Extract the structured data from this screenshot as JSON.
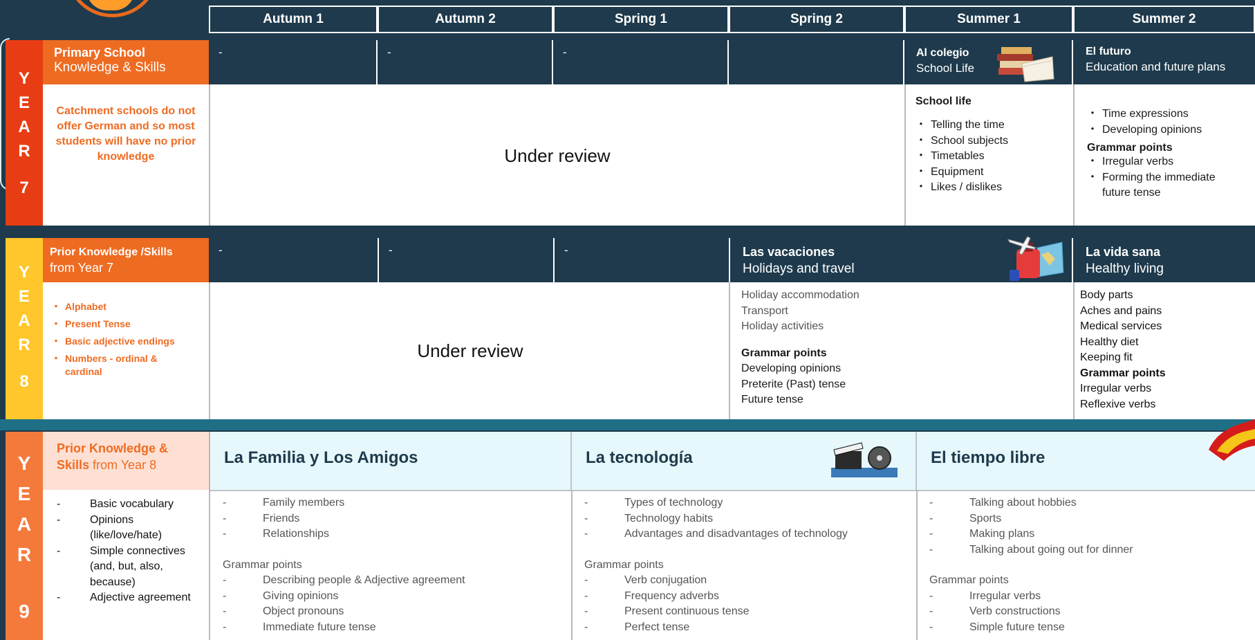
{
  "header": [
    "Autumn 1",
    "Autumn 2",
    "Spring 1",
    "Spring 2",
    "Summer 1",
    "Summer 2"
  ],
  "year7": {
    "label": [
      "Y",
      "E",
      "A",
      "R"
    ],
    "number": "7",
    "prior_title": "Primary School",
    "prior_sub": "Knowledge & Skills",
    "prior_text": "Catchment schools do not offer German and so most students will have no prior knowledge",
    "dashes": [
      "-",
      "-",
      "-"
    ],
    "review": "Under review",
    "summer1": {
      "title": "Al colegio",
      "sub": "School Life",
      "heading": "School life",
      "items": [
        "Telling the time",
        "School subjects",
        "Timetables",
        "Equipment",
        "Likes / dislikes"
      ]
    },
    "summer2": {
      "title": "El futuro",
      "sub": "Education and future plans",
      "items": [
        "Time expressions",
        "Developing opinions"
      ],
      "grammar_heading": "Grammar points",
      "grammar": [
        "Irregular verbs",
        "Forming the immediate future tense"
      ]
    }
  },
  "year8": {
    "label": [
      "Y",
      "E",
      "A",
      "R"
    ],
    "number": "8",
    "prior_title": "Prior Knowledge /Skills",
    "prior_sub": "from Year 7",
    "prior_items": [
      "Alphabet",
      "Present Tense",
      "Basic adjective endings",
      "Numbers - ordinal & cardinal"
    ],
    "dashes": [
      "-",
      "-",
      "-"
    ],
    "review": "Under review",
    "vacaciones": {
      "title": "Las vacaciones",
      "sub": "Holidays and travel",
      "items": [
        "Holiday accommodation",
        "Transport",
        "Holiday activities"
      ],
      "grammar_heading": "Grammar points",
      "grammar": [
        "Developing opinions",
        "Preterite (Past) tense",
        "Future tense"
      ]
    },
    "vida": {
      "title": "La vida sana",
      "sub": "Healthy living",
      "items": [
        "Body parts",
        "Aches and pains",
        "Medical services",
        "Healthy diet",
        "Keeping fit"
      ],
      "grammar_heading": "Grammar points",
      "grammar": [
        "Irregular verbs",
        "Reflexive verbs"
      ]
    }
  },
  "year9": {
    "label": [
      "Y",
      "E",
      "A",
      "R"
    ],
    "number": "9",
    "prior_title_bold": "Prior Knowledge & Skills",
    "prior_title_rest": " from Year 8",
    "prior_items": [
      "Basic vocabulary",
      "Opinions (like/love/hate)",
      "Simple connectives (and, but, also, because)",
      "Adjective agreement"
    ],
    "familia": {
      "title": "La Familia y Los Amigos",
      "items": [
        "Family members",
        "Friends",
        "Relationships"
      ],
      "grammar_heading": "Grammar points",
      "grammar": [
        "Describing people & Adjective agreement",
        "Giving opinions",
        "Object pronouns",
        "Immediate future tense"
      ]
    },
    "tecnologia": {
      "title": "La tecnología",
      "items": [
        "Types of technology",
        "Technology habits",
        "Advantages and disadvantages of technology"
      ],
      "grammar_heading": "Grammar points",
      "grammar": [
        "Verb conjugation",
        "Frequency adverbs",
        "Present continuous tense",
        "Perfect tense"
      ]
    },
    "tiempo": {
      "title": "El tiempo libre",
      "items": [
        "Talking about hobbies",
        "Sports",
        "Making plans",
        "Talking about going out for dinner"
      ],
      "grammar_heading": "Grammar points",
      "grammar": [
        "Irregular verbs",
        "Verb constructions",
        "Simple future tense"
      ]
    }
  },
  "colors": {
    "navy": "#1e3a4c",
    "orange": "#ee6b22",
    "red": "#e83d14",
    "yellow": "#ffc72c",
    "year9_orange": "#f47a3c",
    "peach": "#fde0d3",
    "light_cyan": "#e6f8fb"
  }
}
